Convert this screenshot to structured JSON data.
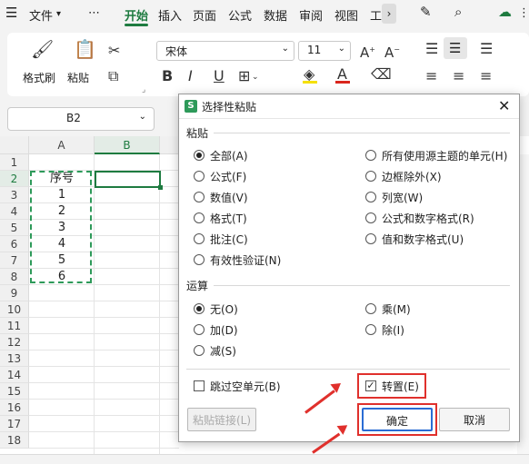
{
  "menubar": {
    "file_label": "文件",
    "more_label": "⋯",
    "tabs": [
      "开始",
      "插入",
      "页面",
      "公式",
      "数据",
      "审阅",
      "视图",
      "工"
    ],
    "active_tab": "开始"
  },
  "ribbon": {
    "format_painter": "格式刷",
    "paste": "粘贴",
    "font_name": "宋体",
    "font_size": "11",
    "bold": "B",
    "italic": "I",
    "underline": "U",
    "font_inc": "A⁺",
    "font_dec": "A⁻",
    "font_color_letter": "A",
    "accent_color": "#1e7b40",
    "highlight_color": "#f5e000",
    "font_color": "#d9251c"
  },
  "formula_bar": {
    "name_box": "B2"
  },
  "grid": {
    "col_headers": [
      "A",
      "B"
    ],
    "row_headers": [
      "1",
      "2",
      "3",
      "4",
      "5",
      "6",
      "7",
      "8",
      "9",
      "10",
      "11",
      "12",
      "13",
      "14",
      "15",
      "16",
      "17",
      "18"
    ],
    "colA_values": [
      "序号",
      "1",
      "2",
      "3",
      "4",
      "5",
      "6"
    ]
  },
  "dialog": {
    "title": "选择性粘贴",
    "title_icon_letter": "S",
    "paste_section": "粘贴",
    "paste_left": [
      "全部(A)",
      "公式(F)",
      "数值(V)",
      "格式(T)",
      "批注(C)",
      "有效性验证(N)"
    ],
    "paste_right": [
      "所有使用源主题的单元(H)",
      "边框除外(X)",
      "列宽(W)",
      "公式和数字格式(R)",
      "值和数字格式(U)"
    ],
    "operation_section": "运算",
    "op_left": [
      "无(O)",
      "加(D)",
      "减(S)"
    ],
    "op_right": [
      "乘(M)",
      "除(I)"
    ],
    "skip_blanks": "跳过空单元(B)",
    "transpose": "转置(E)",
    "paste_link": "粘贴链接(L)",
    "ok": "确定",
    "cancel": "取消"
  }
}
